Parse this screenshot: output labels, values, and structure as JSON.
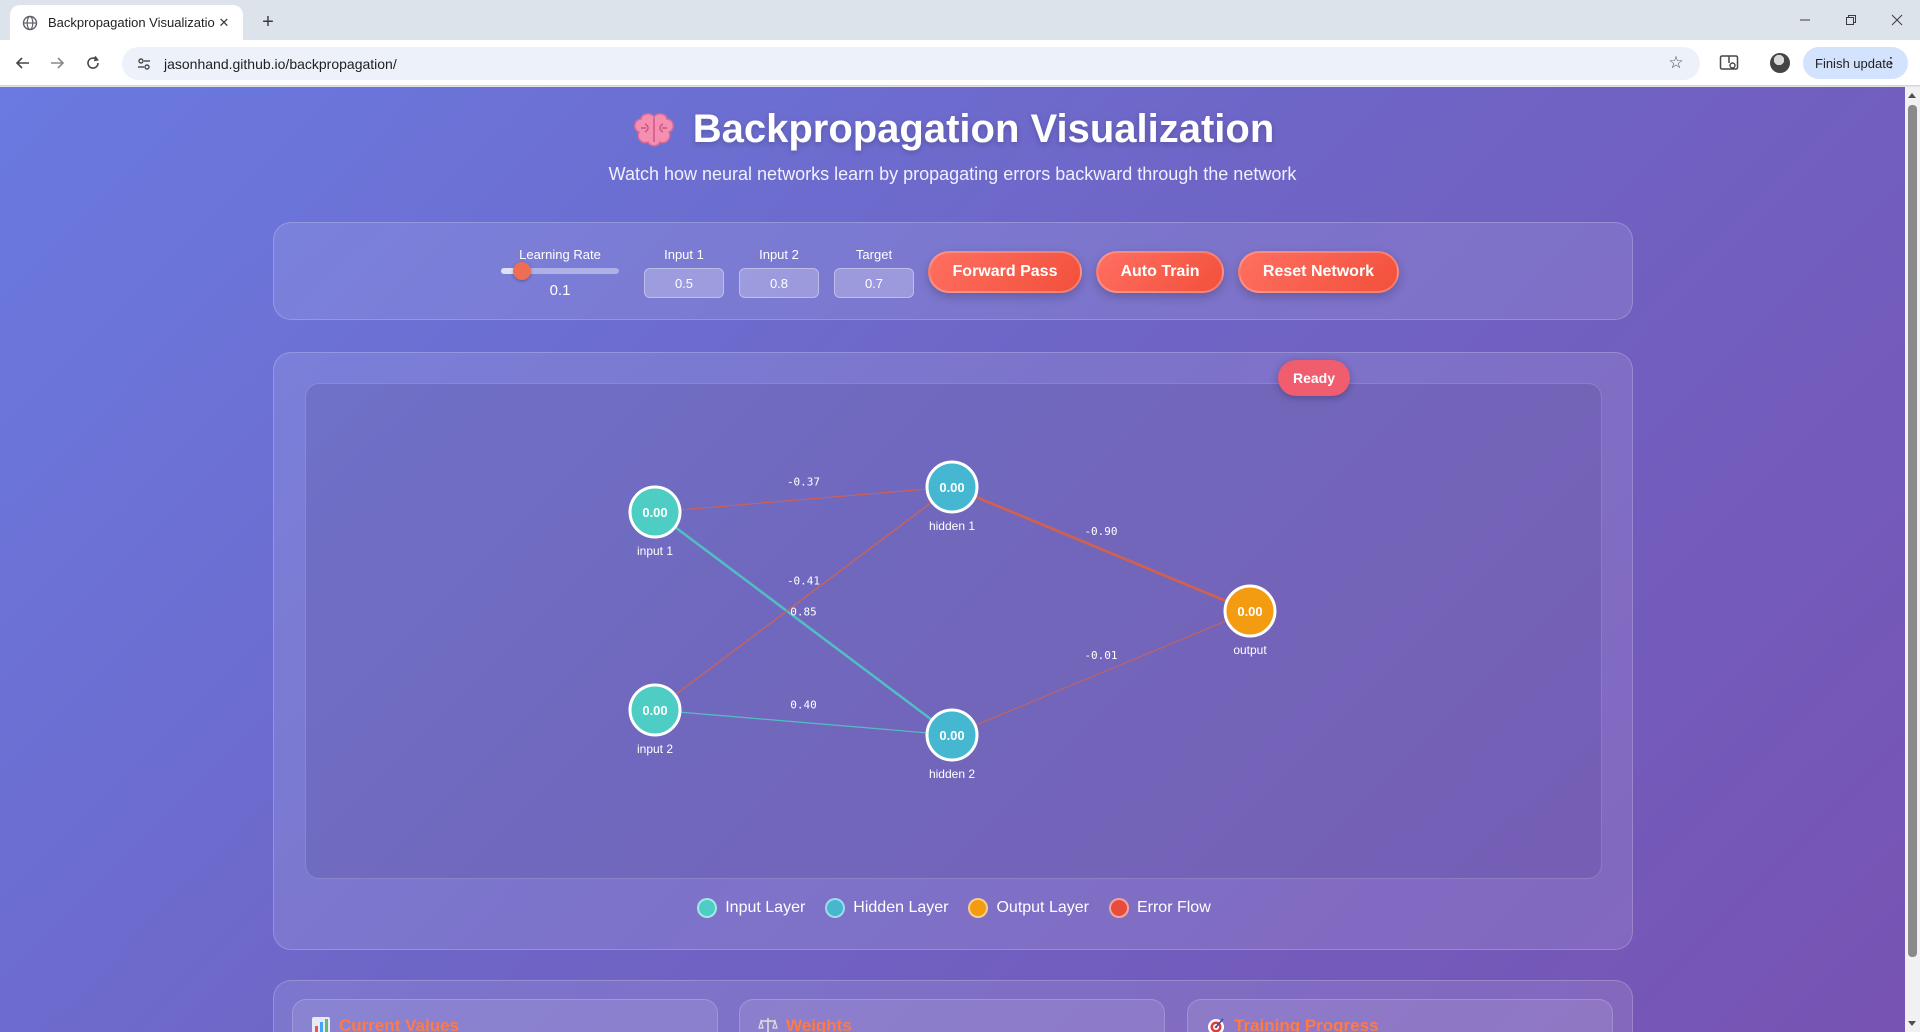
{
  "browser": {
    "tab_title": "Backpropagation Visualization",
    "url": "jasonhand.github.io/backpropagation/",
    "finish_update": "Finish update"
  },
  "header": {
    "title": "Backpropagation Visualization",
    "subtitle": "Watch how neural networks learn by propagating errors backward through the network"
  },
  "controls": {
    "learning_rate_label": "Learning Rate",
    "learning_rate_value": "0.1",
    "learning_rate_fraction": 0.1,
    "input1_label": "Input 1",
    "input1_value": "0.5",
    "input2_label": "Input 2",
    "input2_value": "0.8",
    "target_label": "Target",
    "target_value": "0.7",
    "forward_pass": "Forward Pass",
    "auto_train": "Auto Train",
    "reset_network": "Reset Network"
  },
  "status": "Ready",
  "network": {
    "nodes": [
      {
        "id": "input1",
        "label": "input 1",
        "value": "0.00",
        "layer": "input"
      },
      {
        "id": "input2",
        "label": "input 2",
        "value": "0.00",
        "layer": "input"
      },
      {
        "id": "hidden1",
        "label": "hidden 1",
        "value": "0.00",
        "layer": "hidden"
      },
      {
        "id": "hidden2",
        "label": "hidden 2",
        "value": "0.00",
        "layer": "hidden"
      },
      {
        "id": "output",
        "label": "output",
        "value": "0.00",
        "layer": "output"
      }
    ],
    "edges": [
      {
        "from": "input1",
        "to": "hidden1",
        "weight": "-0.37"
      },
      {
        "from": "input1",
        "to": "hidden2",
        "weight": "0.85"
      },
      {
        "from": "input2",
        "to": "hidden1",
        "weight": "-0.41"
      },
      {
        "from": "input2",
        "to": "hidden2",
        "weight": "0.40"
      },
      {
        "from": "hidden1",
        "to": "output",
        "weight": "-0.90"
      },
      {
        "from": "hidden2",
        "to": "output",
        "weight": "-0.01"
      }
    ]
  },
  "legend": [
    {
      "label": "Input Layer",
      "color": "#4ecdc4"
    },
    {
      "label": "Hidden Layer",
      "color": "#45b7d1"
    },
    {
      "label": "Output Layer",
      "color": "#f39c12"
    },
    {
      "label": "Error Flow",
      "color": "#e74c3c"
    }
  ],
  "colors": {
    "input_node": "#4ecdc4",
    "hidden_node": "#45b7d1",
    "output_node": "#f39c12",
    "positive_edge": "#4ecdc4",
    "negative_edge": "#e0603f",
    "accent": "#f2503b"
  },
  "stats": [
    {
      "title": "Current Values",
      "icon": "chart-icon"
    },
    {
      "title": "Weights",
      "icon": "scale-icon"
    },
    {
      "title": "Training Progress",
      "icon": "target-icon"
    }
  ]
}
